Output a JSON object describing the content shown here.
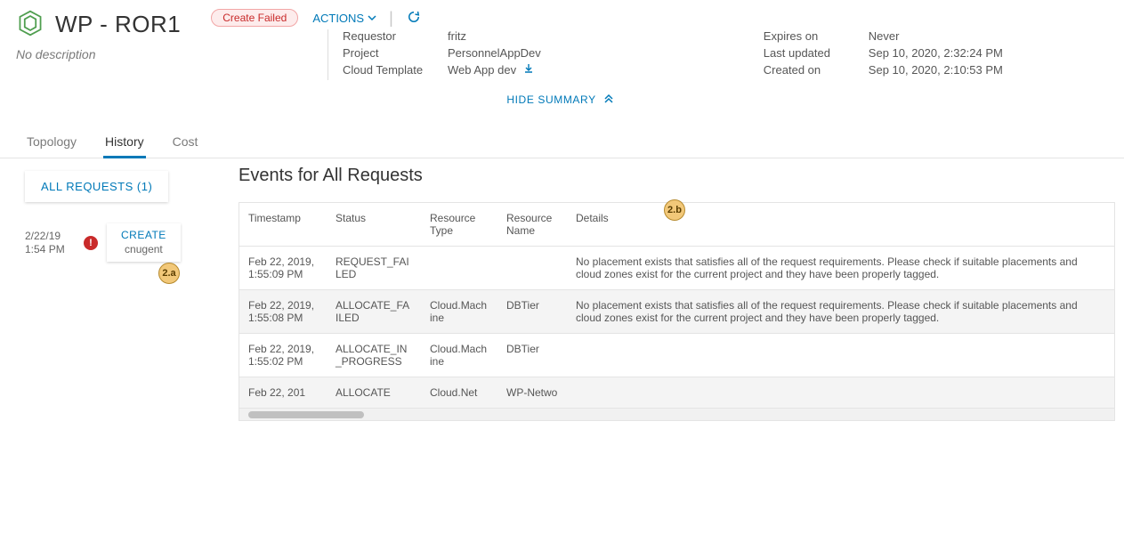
{
  "header": {
    "title": "WP - ROR1",
    "status_badge": "Create Failed",
    "actions_label": "ACTIONS",
    "description": "No description"
  },
  "summary": {
    "left": {
      "requestor_label": "Requestor",
      "requestor_value": "fritz",
      "project_label": "Project",
      "project_value": "PersonnelAppDev",
      "template_label": "Cloud Template",
      "template_value": "Web App dev"
    },
    "right": {
      "expires_label": "Expires on",
      "expires_value": "Never",
      "updated_label": "Last updated",
      "updated_value": "Sep 10, 2020, 2:32:24 PM",
      "created_label": "Created on",
      "created_value": "Sep 10, 2020, 2:10:53 PM"
    },
    "hide_label": "HIDE SUMMARY"
  },
  "tabs": {
    "topology": "Topology",
    "history": "History",
    "cost": "Cost"
  },
  "sidebar": {
    "all_requests": "ALL REQUESTS (1)",
    "request": {
      "date": "2/22/19",
      "time": "1:54 PM",
      "action": "CREATE",
      "user": "cnugent"
    }
  },
  "events": {
    "title": "Events for All Requests",
    "headers": {
      "timestamp": "Timestamp",
      "status": "Status",
      "rtype": "Resource Type",
      "rname": "Resource Name",
      "details": "Details"
    },
    "rows": [
      {
        "timestamp": "Feb 22, 2019, 1:55:09 PM",
        "status": "REQUEST_FAILED",
        "rtype": "",
        "rname": "",
        "details": "No placement exists that satisfies all of the request requirements. Please check if suitable placements and cloud zones exist for the current project and they have been properly tagged."
      },
      {
        "timestamp": "Feb 22, 2019, 1:55:08 PM",
        "status": "ALLOCATE_FAILED",
        "rtype": "Cloud.Machine",
        "rname": "DBTier",
        "details": "No placement exists that satisfies all of the request requirements. Please check if suitable placements and cloud zones exist for the current project and they have been properly tagged."
      },
      {
        "timestamp": "Feb 22, 2019, 1:55:02 PM",
        "status": "ALLOCATE_IN_PROGRESS",
        "rtype": "Cloud.Machine",
        "rname": "DBTier",
        "details": ""
      },
      {
        "timestamp": "Feb 22, 201",
        "status": "ALLOCATE",
        "rtype": "Cloud.Net",
        "rname": "WP-Netwo",
        "details": ""
      }
    ]
  },
  "callouts": {
    "a": "2.a",
    "b": "2.b"
  }
}
